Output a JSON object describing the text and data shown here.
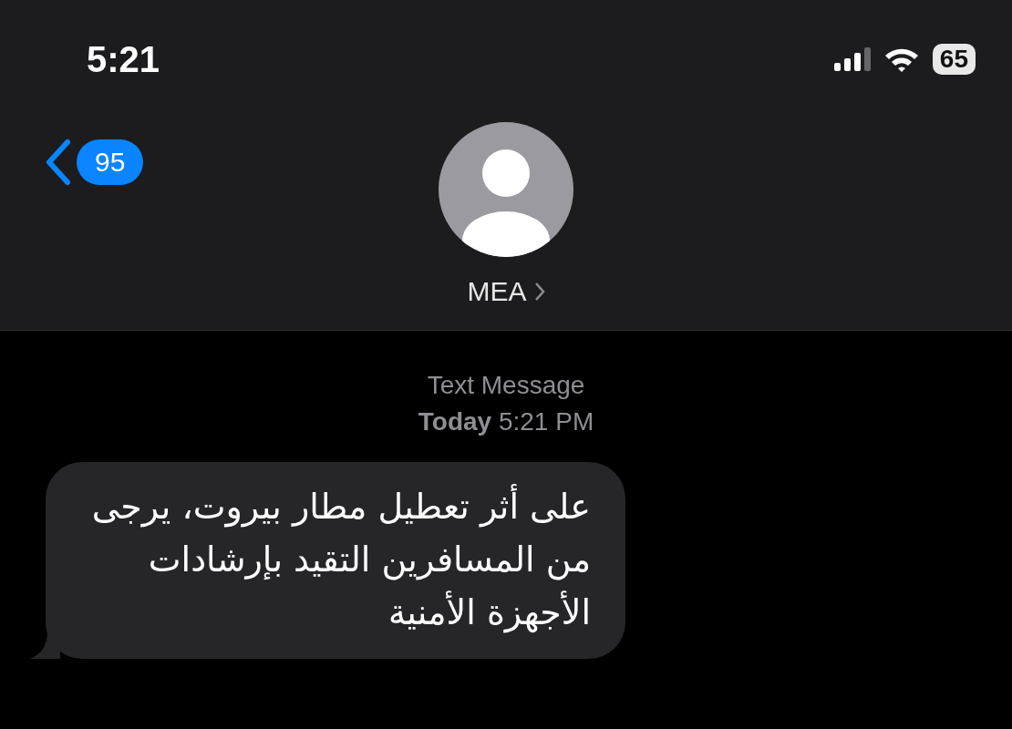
{
  "status_bar": {
    "time": "5:21",
    "battery": "65"
  },
  "header": {
    "back_badge": "95",
    "contact": "MEA"
  },
  "thread": {
    "service": "Text Message",
    "timestamp": "**Today** 5:21 PM",
    "messages": [
      {
        "kind": "incoming",
        "text": "على أثر تعطيل مطار بيروت، يرجى من المسافرين التقيد بإرشادات الأجهزة الأمنية"
      }
    ]
  }
}
